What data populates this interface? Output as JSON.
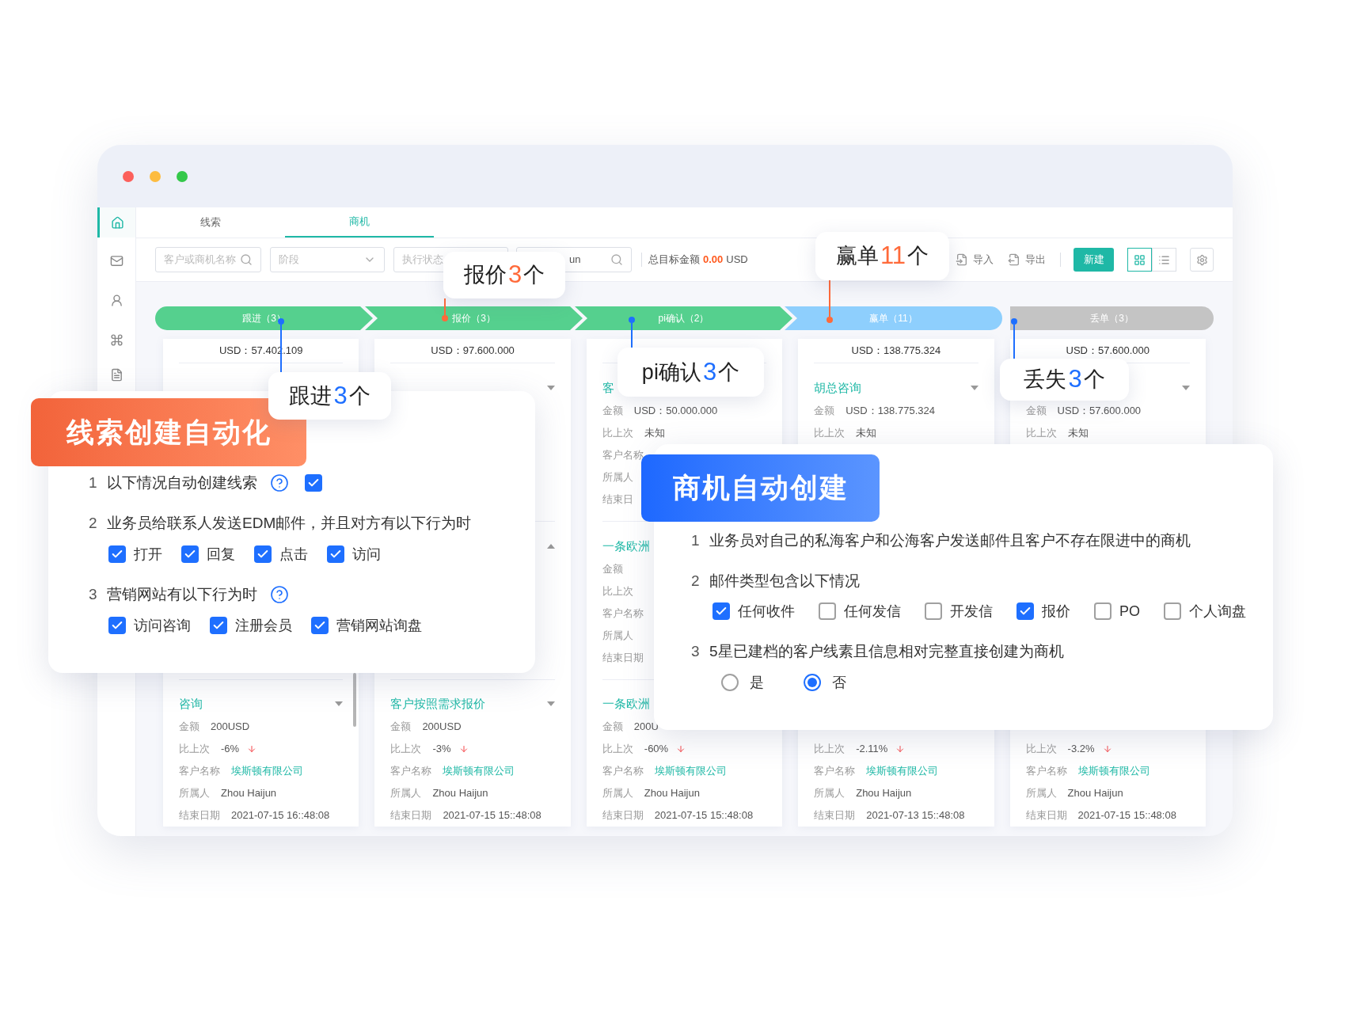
{
  "window": {
    "traffic_lights": [
      {
        "color": "#fc605b"
      },
      {
        "color": "#fdbc40"
      },
      {
        "color": "#34c84a"
      }
    ]
  },
  "sidebar": {
    "items": [
      {
        "kind": "home",
        "selected": true
      },
      {
        "kind": "mail",
        "selected": false
      },
      {
        "kind": "user",
        "selected": false
      },
      {
        "kind": "command",
        "selected": false
      },
      {
        "kind": "document",
        "selected": false
      }
    ]
  },
  "tabs": [
    {
      "label": "线索",
      "selected": false
    },
    {
      "label": "商机",
      "selected": true
    }
  ],
  "filters": [
    {
      "kind": "search",
      "placeholder": "客户或商机名称"
    },
    {
      "kind": "select",
      "placeholder": "阶段"
    },
    {
      "kind": "plain",
      "placeholder": "执行状态"
    },
    {
      "kind": "partial_search",
      "value": "un"
    }
  ],
  "target_total": {
    "label": "总目标金额",
    "amount": "0.00",
    "currency": "USD"
  },
  "actions": [
    {
      "kind": "import",
      "label": "导入"
    },
    {
      "kind": "export",
      "label": "导出"
    }
  ],
  "new_button": {
    "label": "新建"
  },
  "view_modes": [
    {
      "kind": "grid",
      "selected": true
    },
    {
      "kind": "list",
      "selected": false
    }
  ],
  "stages": [
    {
      "label": "跟进（3）",
      "color": "#55d08e",
      "kind": "start"
    },
    {
      "label": "报价（3）",
      "color": "#55d08e",
      "kind": "step"
    },
    {
      "label": "pi确认（2）",
      "color": "#55d08e",
      "kind": "step"
    },
    {
      "label": "赢单（11）",
      "color": "#8ecffd",
      "kind": "end"
    },
    {
      "label": "丢单（3）",
      "color": "#c4c4c4",
      "kind": "separate"
    }
  ],
  "columns": [
    {
      "total": "USD：57.402.109",
      "scrollbar": true,
      "bottom": {
        "title": "咨询",
        "expanded": false,
        "rows": [
          {
            "label": "金额",
            "value": "200USD"
          },
          {
            "label": "比上次",
            "value": "-6%",
            "falling": true
          },
          {
            "label": "客户名称",
            "value": "埃斯顿有限公司",
            "link": true
          },
          {
            "label": "所属人",
            "value": "Zhou Haijun"
          },
          {
            "label": "结束日期",
            "value": "2021-07-15 16::48:08"
          }
        ]
      }
    },
    {
      "total": "USD：97.600.000",
      "scrollbar": false,
      "top": {
        "expanded": false
      },
      "middle": {
        "expanded": true
      },
      "bottom": {
        "title": "客户按照需求报价",
        "expanded": false,
        "rows": [
          {
            "label": "金额",
            "value": "200USD"
          },
          {
            "label": "比上次",
            "value": "-3%",
            "falling": true
          },
          {
            "label": "客户名称",
            "value": "埃斯顿有限公司",
            "link": true
          },
          {
            "label": "所属人",
            "value": "Zhou Haijun"
          },
          {
            "label": "结束日期",
            "value": "2021-07-15 15::48:08"
          }
        ]
      }
    },
    {
      "scrollbar": false,
      "top": {
        "title": "客",
        "rows": [
          {
            "label": "金额",
            "value": "USD：50.000.000"
          },
          {
            "label": "比上次",
            "value": "未知"
          },
          {
            "label": "客户名称"
          },
          {
            "label": "所属人"
          },
          {
            "label": "结束日"
          }
        ]
      },
      "middle": {
        "title": "一条欧洲",
        "rows": [
          {
            "label": "金额"
          },
          {
            "label": "比上次"
          },
          {
            "label": "客户名称"
          },
          {
            "label": "所属人"
          },
          {
            "label": "结束日期"
          }
        ]
      },
      "bottom": {
        "title": "一条欧洲",
        "rows": [
          {
            "label": "金额",
            "value": "200U"
          },
          {
            "label": "比上次",
            "value": "-60%",
            "falling": true
          },
          {
            "label": "客户名称",
            "value": "埃斯顿有限公司",
            "link": true
          },
          {
            "label": "所属人",
            "value": "Zhou Haijun"
          },
          {
            "label": "结束日期",
            "value": "2021-07-15 15::48:08"
          }
        ]
      }
    },
    {
      "total": "USD：138.775.324",
      "scrollbar": false,
      "top": {
        "title": "胡总咨询",
        "expanded": false,
        "rows": [
          {
            "label": "金额",
            "value": "USD：138.775.324"
          },
          {
            "label": "比上次",
            "value": "未知"
          }
        ]
      },
      "bottom": {
        "rows": [
          {
            "label": "比上次",
            "value": "-2.11%",
            "falling": true
          },
          {
            "label": "客户名称",
            "value": "埃斯顿有限公司",
            "link": true
          },
          {
            "label": "所属人",
            "value": "Zhou Haijun"
          },
          {
            "label": "结束日期",
            "value": "2021-07-13 15::48:08"
          }
        ]
      }
    },
    {
      "total": "USD：57.600.000",
      "scrollbar": false,
      "top": {
        "expanded": false,
        "rows": [
          {
            "label": "金额",
            "value": "USD：57.600.000"
          },
          {
            "label": "比上次",
            "value": "未知"
          }
        ]
      },
      "bottom": {
        "rows": [
          {
            "label": "比上次",
            "value": "-3.2%",
            "falling": true
          },
          {
            "label": "客户名称",
            "value": "埃斯顿有限公司",
            "link": true
          },
          {
            "label": "所属人",
            "value": "Zhou Haijun"
          },
          {
            "label": "结束日期",
            "value": "2021-07-15 15::48:08"
          }
        ]
      }
    }
  ],
  "callouts": [
    {
      "label": "报价",
      "count": "3",
      "unit": "个",
      "color": "#ff6a3a"
    },
    {
      "label": "跟进",
      "count": "3",
      "unit": "个",
      "color": "#1e6fff"
    },
    {
      "label": "pi确认",
      "count": "3",
      "unit": "个",
      "color": "#1e6fff"
    },
    {
      "label": "赢单",
      "count": "11",
      "unit": "个",
      "color": "#ff6a3a"
    },
    {
      "label": "丢失",
      "count": "3",
      "unit": "个",
      "color": "#1e6fff"
    }
  ],
  "lead_panel": {
    "title": "线索创建自动化",
    "items": [
      {
        "kind": "toggle",
        "number": "1",
        "text": "以下情况自动创建线索",
        "help": true,
        "checked": true
      },
      {
        "kind": "options",
        "number": "2",
        "text": "业务员给联系人发送EDM邮件，并且对方有以下行为时",
        "help": false,
        "options": [
          {
            "label": "打开",
            "checked": true
          },
          {
            "label": "回复",
            "checked": true
          },
          {
            "label": "点击",
            "checked": true
          },
          {
            "label": "访问",
            "checked": true
          }
        ]
      },
      {
        "kind": "options",
        "number": "3",
        "text": "营销网站有以下行为时",
        "help": true,
        "options": [
          {
            "label": "访问咨询",
            "checked": true
          },
          {
            "label": "注册会员",
            "checked": true
          },
          {
            "label": "营销网站询盘",
            "checked": true
          }
        ]
      }
    ]
  },
  "deal_panel": {
    "title": "商机自动创建",
    "items": [
      {
        "kind": "text",
        "number": "1",
        "text": "业务员对自己的私海客户和公海客户发送邮件且客户不存在限进中的商机"
      },
      {
        "kind": "options",
        "number": "2",
        "text": "邮件类型包含以下情况",
        "options": [
          {
            "label": "任何收件",
            "checked": true
          },
          {
            "label": "任何发信",
            "checked": false
          },
          {
            "label": "开发信",
            "checked": false
          },
          {
            "label": "报价",
            "checked": true
          },
          {
            "label": "PO",
            "checked": false
          },
          {
            "label": "个人询盘",
            "checked": false
          }
        ]
      },
      {
        "kind": "radio",
        "number": "3",
        "text": "5星已建档的客户线素且信息相对完整直接创建为商机",
        "options": [
          {
            "label": "是",
            "selected": false
          },
          {
            "label": "否",
            "selected": true
          }
        ]
      }
    ]
  }
}
